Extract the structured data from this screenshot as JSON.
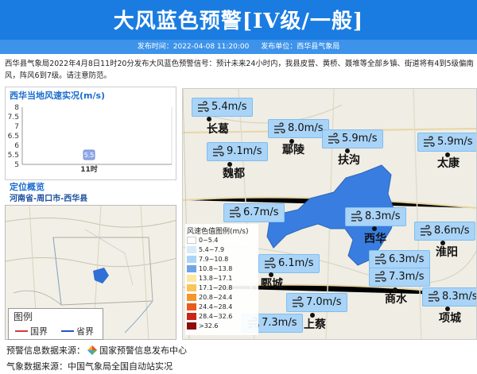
{
  "header": {
    "title": "大风蓝色预警[IV级/一般]",
    "publish_time_label": "发布时间：2022-04-08 11:20:00",
    "publish_unit_label": "发布单位：西华县气象局"
  },
  "description": "西华县气象局2022年4月8日11时20分发布大风蓝色预警信号：预计未来24小时内，我县皮营、黄桥、聂堆等全部乡镇、街道将有4到5级偏南风，阵风6到7级。请注意防范。",
  "wind_panel": {
    "title": "西华当地风速实况(m/s)",
    "chart_data": {
      "type": "scatter",
      "categories": [
        "11时"
      ],
      "values": [
        5.5
      ],
      "title": "西华当地风速实况(m/s)",
      "xlabel": "",
      "ylabel": "",
      "ylim": [
        5,
        8
      ],
      "yticks": [
        "5",
        "5.5",
        "6",
        "6.5",
        "7",
        "7.5",
        "8"
      ],
      "data_labels": [
        "5.5"
      ]
    }
  },
  "location": {
    "title": "定位概览",
    "path": "河南省-周口市-西华县",
    "legend": {
      "title": "图例",
      "items": [
        {
          "label": "国界",
          "color": "#d23a3a"
        },
        {
          "label": "省界",
          "color": "#2255cc"
        }
      ]
    }
  },
  "main_map": {
    "cities": [
      {
        "name": "长葛"
      },
      {
        "name": "鄢陵"
      },
      {
        "name": "扶沟"
      },
      {
        "name": "太康"
      },
      {
        "name": "魏都"
      },
      {
        "name": "西华"
      },
      {
        "name": "淮阳"
      },
      {
        "name": "郾城"
      },
      {
        "name": "商水"
      },
      {
        "name": "上蔡"
      },
      {
        "name": "项城"
      }
    ],
    "wind_tags": [
      "5.4m/s",
      "8.0m/s",
      "5.9m/s",
      "5.9m/s",
      "9.1m/s",
      "6.7m/s",
      "8.3m/s",
      "8.6m/s",
      "6.1m/s",
      "6.3m/s",
      "7.3m/s",
      "7.0m/s",
      "7.3m/s",
      "8.3m/s"
    ],
    "wind_legend": {
      "title": "风速色值图例(m/s)",
      "items": [
        {
          "label": "0~5.4",
          "color": "#ffffff"
        },
        {
          "label": "5.4~7.9",
          "color": "#d6ecfb"
        },
        {
          "label": "7.9~10.8",
          "color": "#a9d4f7"
        },
        {
          "label": "10.8~13.8",
          "color": "#6ea5e8"
        },
        {
          "label": "13.8~17.1",
          "color": "#fde8a0"
        },
        {
          "label": "17.1~20.8",
          "color": "#f9c45a"
        },
        {
          "label": "20.8~24.4",
          "color": "#f4952e"
        },
        {
          "label": "24.4~28.4",
          "color": "#e85a1e"
        },
        {
          "label": "28.4~32.6",
          "color": "#c8251a"
        },
        {
          "label": ">32.6",
          "color": "#8b0e0e"
        }
      ]
    }
  },
  "footer": {
    "source1_label": "预警信息数据来源：",
    "source1_value": "国家预警信息发布中心",
    "source2": "气象数据来源：中国气象局全国自动站实况"
  },
  "colors": {
    "header_bg": "#1a7ce0",
    "accent": "#1a6ccf",
    "county_fill": "#3a7de0",
    "tag_bg": "#a9d4f7"
  }
}
